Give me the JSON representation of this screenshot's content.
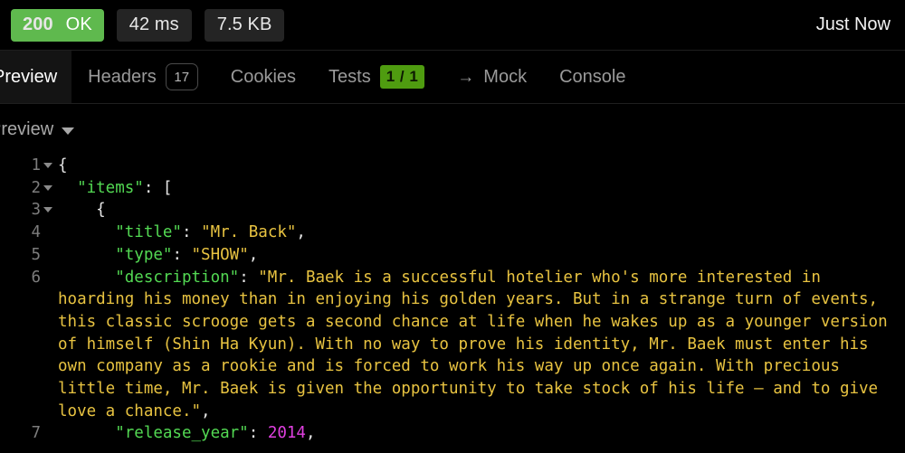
{
  "status_bar": {
    "status_code": "200",
    "status_text": "OK",
    "status_color": "#5fb94e",
    "time": "42 ms",
    "size": "7.5 KB",
    "timestamp": "Just Now"
  },
  "tabs": [
    {
      "label": "Preview",
      "active": true
    },
    {
      "label": "Headers",
      "badge": "17",
      "badge_type": "outline",
      "active": false
    },
    {
      "label": "Cookies",
      "active": false
    },
    {
      "label": "Tests",
      "badge": "1 / 1",
      "badge_type": "green",
      "active": false
    },
    {
      "label": "Mock",
      "icon": "arrow-right-icon",
      "active": false
    },
    {
      "label": "Console",
      "active": false
    }
  ],
  "preview_selector": {
    "label": "Preview",
    "caret": "chevron-down-icon"
  },
  "json_body": {
    "lines": [
      {
        "num": "1",
        "foldable": true,
        "indent": 0,
        "tokens": [
          {
            "t": "p",
            "v": "{"
          }
        ]
      },
      {
        "num": "2",
        "foldable": true,
        "indent": 1,
        "tokens": [
          {
            "t": "k",
            "v": "\"items\""
          },
          {
            "t": "p",
            "v": ": ["
          }
        ]
      },
      {
        "num": "3",
        "foldable": true,
        "indent": 2,
        "tokens": [
          {
            "t": "p",
            "v": "{"
          }
        ]
      },
      {
        "num": "4",
        "foldable": false,
        "indent": 3,
        "tokens": [
          {
            "t": "k",
            "v": "\"title\""
          },
          {
            "t": "p",
            "v": ": "
          },
          {
            "t": "s",
            "v": "\"Mr. Back\""
          },
          {
            "t": "p",
            "v": ","
          }
        ]
      },
      {
        "num": "5",
        "foldable": false,
        "indent": 3,
        "tokens": [
          {
            "t": "k",
            "v": "\"type\""
          },
          {
            "t": "p",
            "v": ": "
          },
          {
            "t": "s",
            "v": "\"SHOW\""
          },
          {
            "t": "p",
            "v": ","
          }
        ]
      },
      {
        "num": "6",
        "foldable": false,
        "indent": 3,
        "tokens": [
          {
            "t": "k",
            "v": "\"description\""
          },
          {
            "t": "p",
            "v": ": "
          },
          {
            "t": "s",
            "v": "\"Mr. Baek is a successful hotelier who's more interested in hoarding his money than in enjoying his golden years. But in a strange turn of events, this classic scrooge gets a second chance at life when he wakes up as a younger version of himself (Shin Ha Kyun). With no way to prove his identity, Mr. Baek must enter his own company as a rookie and is forced to work his way up once again. With precious little time, Mr. Baek is given the opportunity to take stock of his life — and to give love a chance.\""
          },
          {
            "t": "p",
            "v": ","
          }
        ]
      },
      {
        "num": "7",
        "foldable": false,
        "indent": 3,
        "tokens": [
          {
            "t": "k",
            "v": "\"release_year\""
          },
          {
            "t": "p",
            "v": ": "
          },
          {
            "t": "n",
            "v": "2014"
          },
          {
            "t": "p",
            "v": ","
          }
        ]
      }
    ]
  }
}
